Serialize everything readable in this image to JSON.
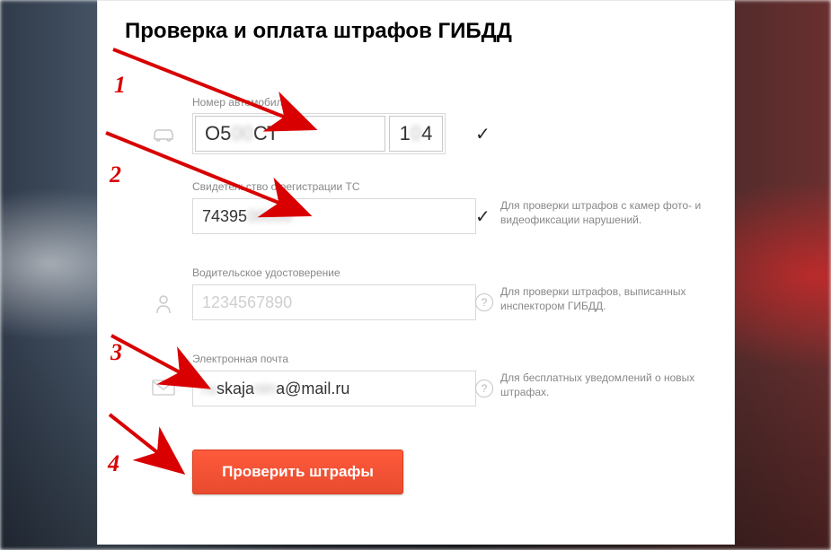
{
  "title": "Проверка и оплата штрафов ГИБДД",
  "plate": {
    "label": "Номер автомобиля",
    "main_left": "О5",
    "main_mid_blur": "00",
    "main_right": "СТ",
    "region_left": "1",
    "region_blur": "0",
    "region_right": "4"
  },
  "sts": {
    "label": "Свидетельство о регистрации ТС",
    "val_left": "74395",
    "val_blur": "00000",
    "help": "Для проверки штрафов с камер фото- и видеофиксации нарушений."
  },
  "license": {
    "label": "Водительское удостоверение",
    "placeholder": "1234567890",
    "help": "Для проверки штрафов, выписанных инспектором ГИБДД."
  },
  "email": {
    "label": "Электронная почта",
    "v1_blur": "ru",
    "v2": "skaja",
    "v3_blur": "nin",
    "v4": "a@mail.ru",
    "help": "Для бесплатных уведомлений о новых штрафах."
  },
  "button": "Проверить штрафы",
  "anno": {
    "n1": "1",
    "n2": "2",
    "n3": "3",
    "n4": "4"
  }
}
